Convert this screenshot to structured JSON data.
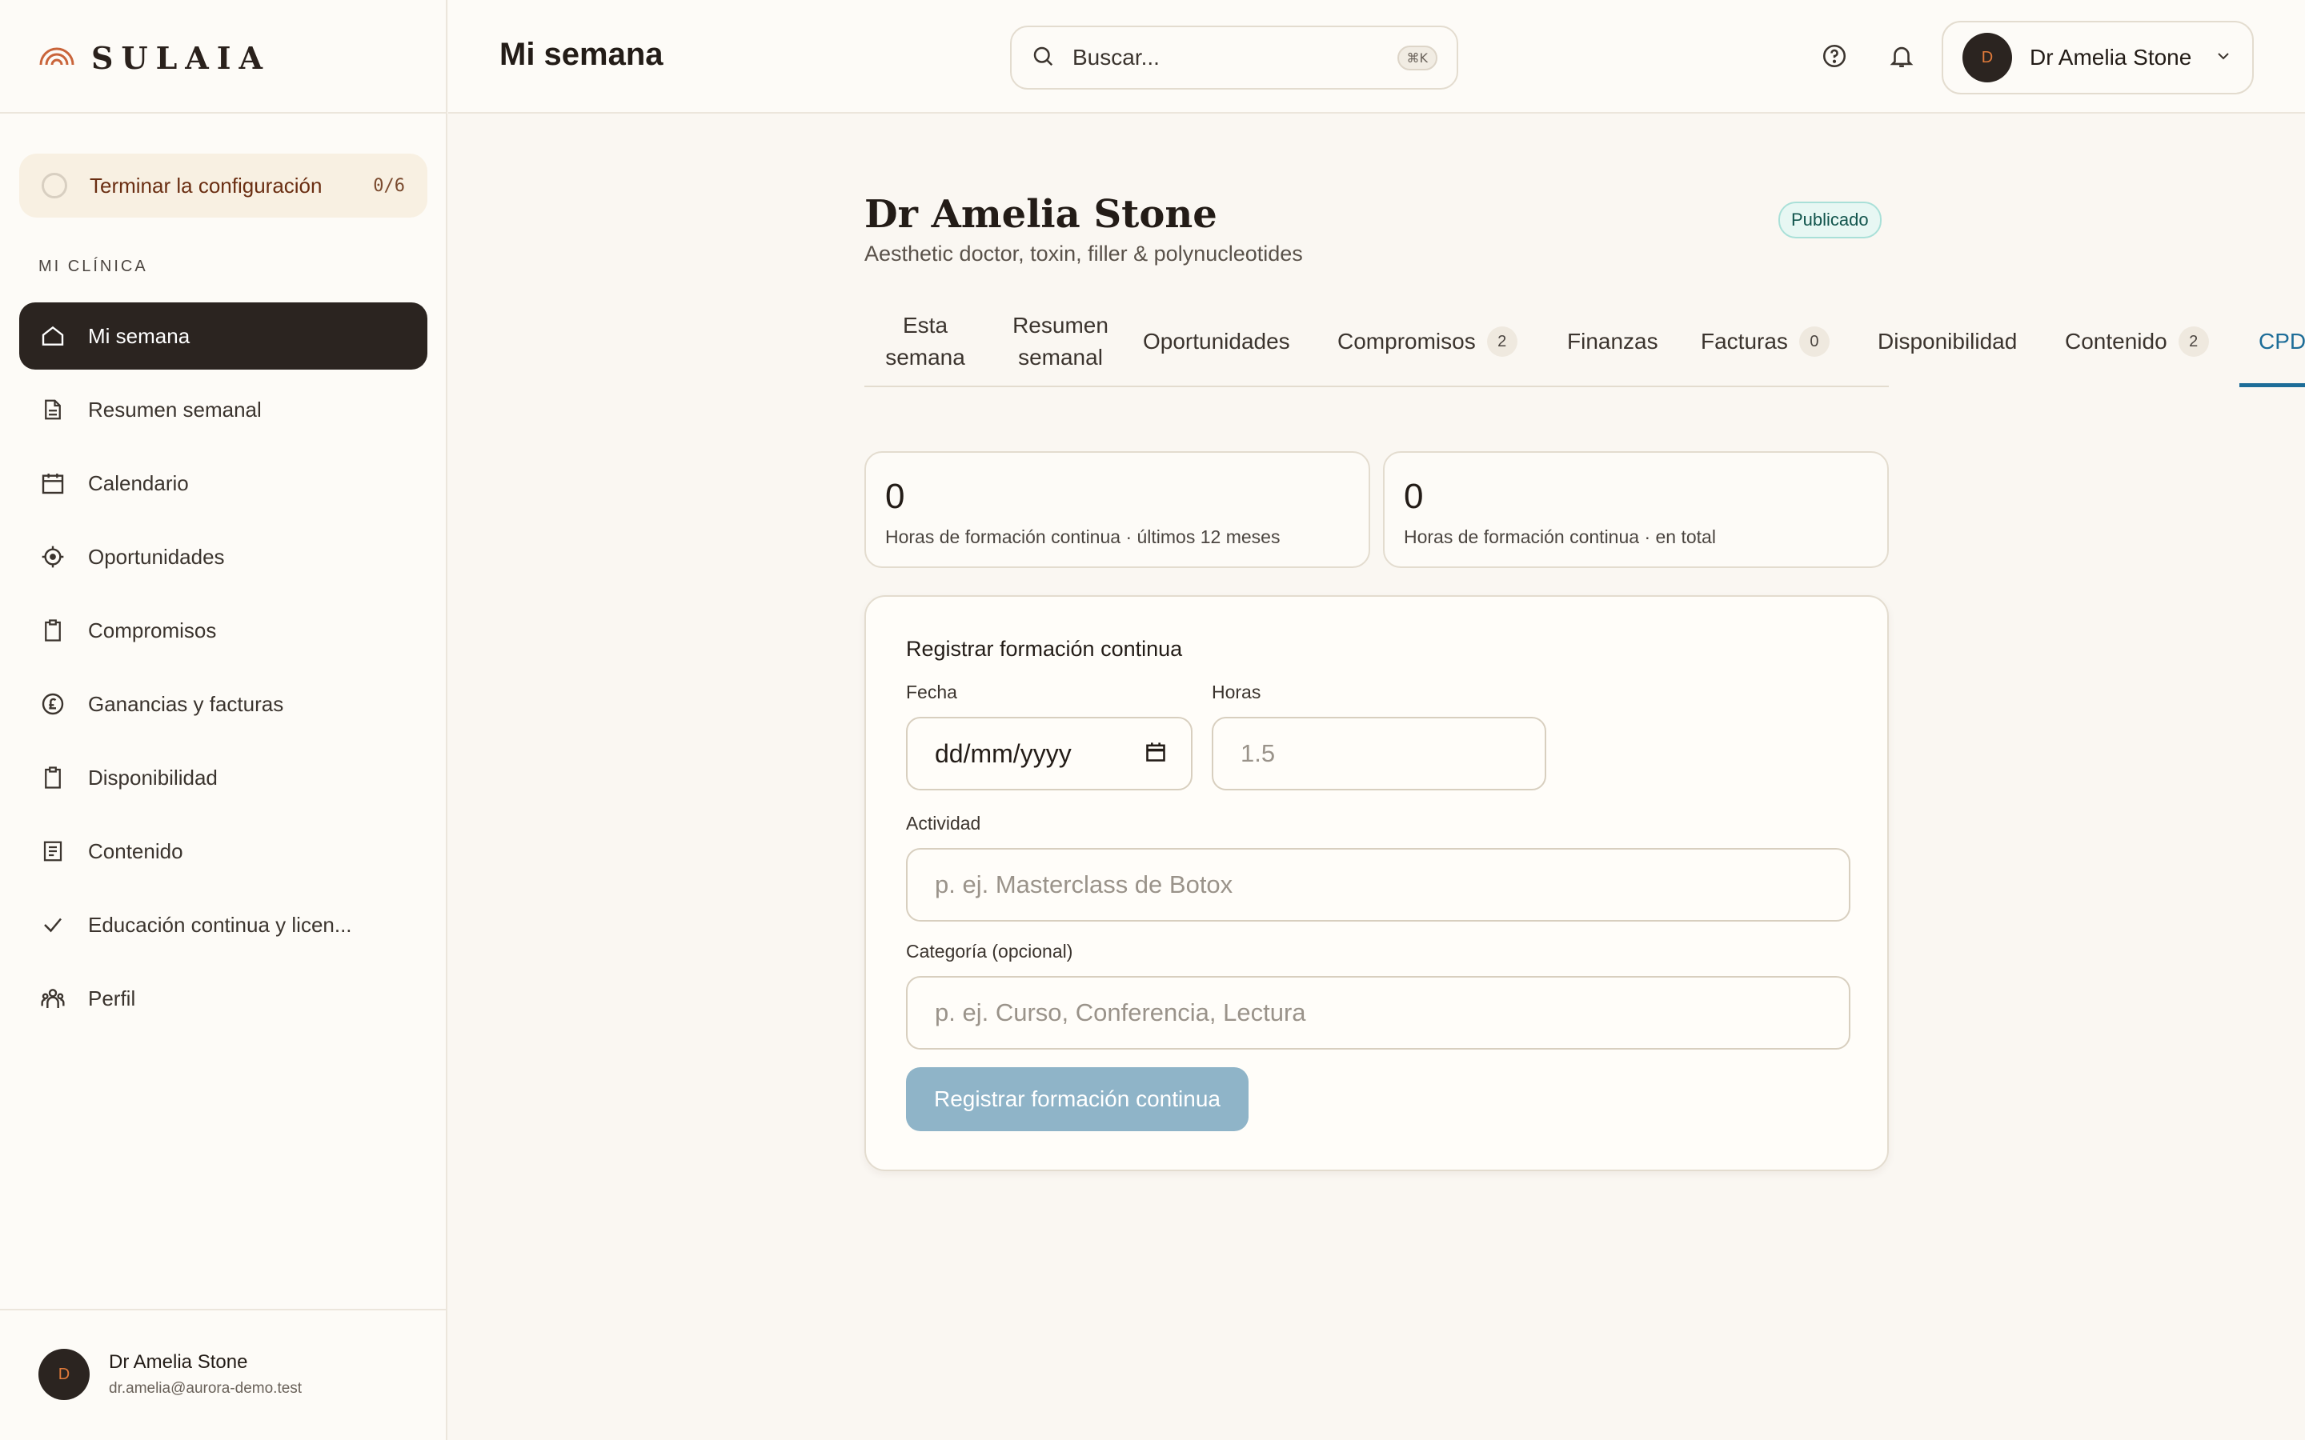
{
  "brand": {
    "name": "SULAIA",
    "accent": "#c9643a"
  },
  "header": {
    "title": "Mi semana",
    "search_placeholder": "Buscar...",
    "search_shortcut": "⌘K",
    "user_name": "Dr Amelia Stone",
    "avatar_initial": "D"
  },
  "setup": {
    "label": "Terminar la configuración",
    "count": "0/6"
  },
  "sidebar": {
    "section_label": "MI CLÍNICA",
    "items": [
      {
        "label": "Mi semana",
        "icon": "home-icon",
        "active": true
      },
      {
        "label": "Resumen semanal",
        "icon": "document-icon"
      },
      {
        "label": "Calendario",
        "icon": "calendar-icon"
      },
      {
        "label": "Oportunidades",
        "icon": "target-icon"
      },
      {
        "label": "Compromisos",
        "icon": "clipboard-icon"
      },
      {
        "label": "Ganancias y facturas",
        "icon": "pound-icon"
      },
      {
        "label": "Disponibilidad",
        "icon": "clipboard-icon"
      },
      {
        "label": "Contenido",
        "icon": "article-icon"
      },
      {
        "label": "Educación continua y licen...",
        "icon": "check-icon"
      },
      {
        "label": "Perfil",
        "icon": "people-icon"
      }
    ],
    "footer": {
      "name": "Dr Amelia Stone",
      "email": "dr.amelia@aurora-demo.test",
      "avatar_initial": "D"
    }
  },
  "profile": {
    "name": "Dr Amelia Stone",
    "subtitle": "Aesthetic doctor, toxin, filler & polynucleotides",
    "status": "Publicado"
  },
  "tabs": [
    {
      "label": "Esta semana"
    },
    {
      "label": "Resumen semanal"
    },
    {
      "label": "Oportunidades"
    },
    {
      "label": "Compromisos",
      "count": "2"
    },
    {
      "label": "Finanzas"
    },
    {
      "label": "Facturas",
      "count": "0"
    },
    {
      "label": "Disponibilidad"
    },
    {
      "label": "Contenido",
      "count": "2"
    },
    {
      "label": "CPD",
      "active": true
    }
  ],
  "stats": [
    {
      "value": "0",
      "label": "Horas de formación continua · últimos 12 meses"
    },
    {
      "value": "0",
      "label": "Horas de formación continua · en total"
    }
  ],
  "form": {
    "title": "Registrar formación continua",
    "date_label": "Fecha",
    "date_placeholder": "dd/mm/yyyy",
    "hours_label": "Horas",
    "hours_placeholder": "1.5",
    "activity_label": "Actividad",
    "activity_placeholder": "p. ej. Masterclass de Botox",
    "category_label": "Categoría (opcional)",
    "category_placeholder": "p. ej. Curso, Conferencia, Lectura",
    "submit_label": "Registrar formación continua"
  }
}
